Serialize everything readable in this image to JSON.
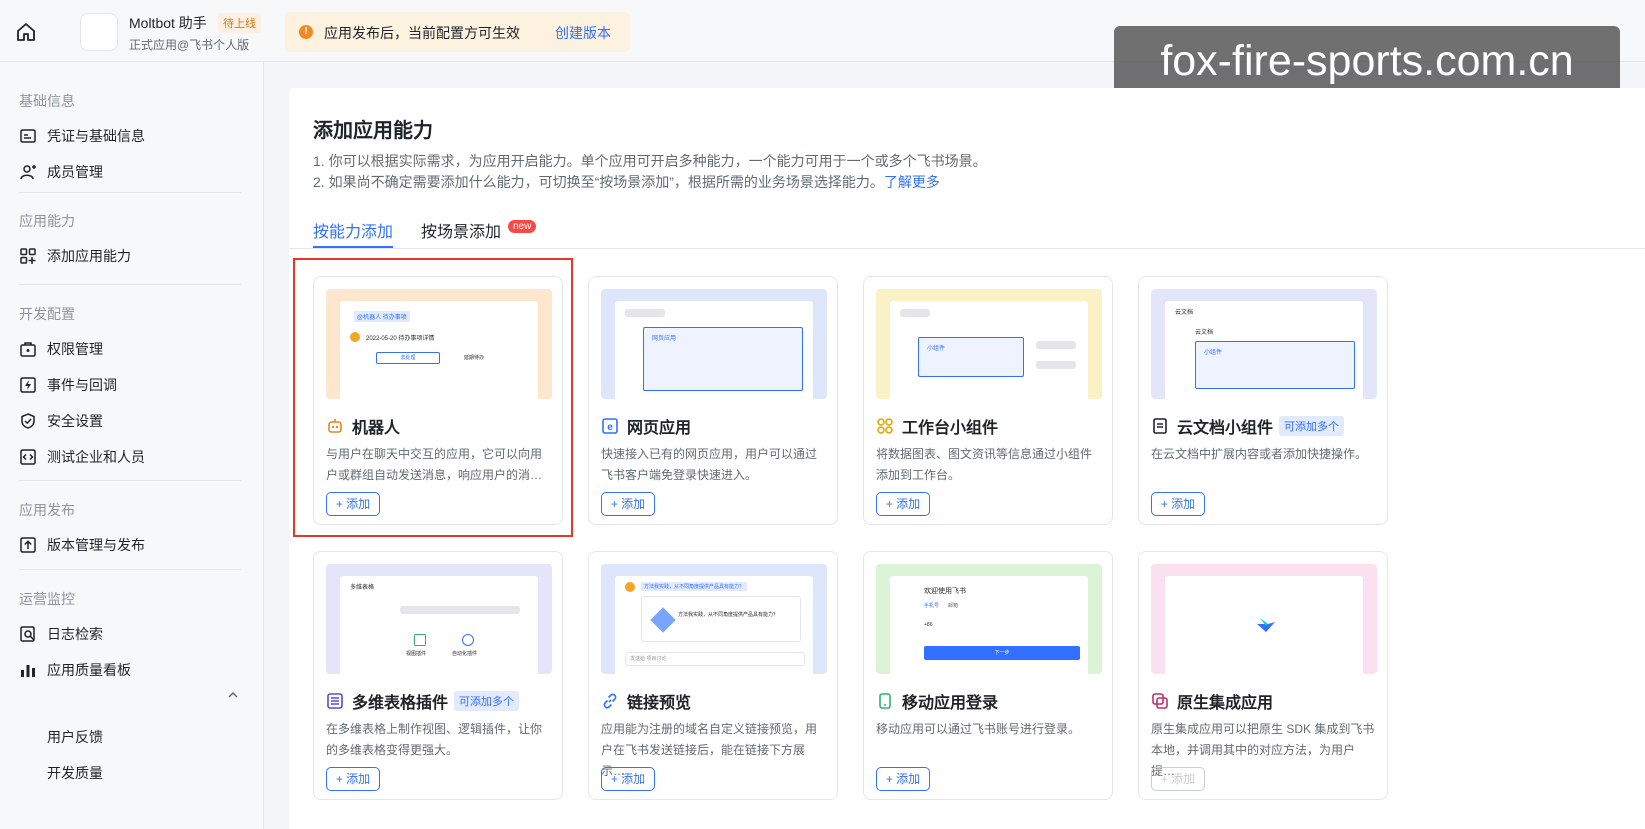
{
  "app": {
    "name": "Moltbot 助手",
    "badge": "待上线",
    "subtitle": "正式应用@飞书个人版"
  },
  "notice": {
    "icon": "warning-icon",
    "text": "应用发布后，当前配置方可生效",
    "link": "创建版本"
  },
  "watermark": "fox-fire-sports.com.cn",
  "sidebar": {
    "groups": [
      {
        "label": "基础信息",
        "items": [
          {
            "label": "凭证与基础信息",
            "icon": "credential-icon"
          },
          {
            "label": "成员管理",
            "icon": "user-add-icon"
          }
        ]
      },
      {
        "label": "应用能力",
        "items": [
          {
            "label": "添加应用能力",
            "icon": "apps-add-icon"
          }
        ]
      },
      {
        "label": "开发配置",
        "items": [
          {
            "label": "权限管理",
            "icon": "permission-icon"
          },
          {
            "label": "事件与回调",
            "icon": "event-icon"
          },
          {
            "label": "安全设置",
            "icon": "shield-icon"
          },
          {
            "label": "测试企业和人员",
            "icon": "code-icon"
          }
        ]
      },
      {
        "label": "应用发布",
        "items": [
          {
            "label": "版本管理与发布",
            "icon": "upload-icon"
          }
        ]
      },
      {
        "label": "运营监控",
        "items": [
          {
            "label": "日志检索",
            "icon": "log-search-icon"
          },
          {
            "label": "应用质量看板",
            "icon": "chart-icon"
          }
        ]
      }
    ],
    "sub_items": [
      "用户反馈",
      "开发质量"
    ]
  },
  "main": {
    "title": "添加应用能力",
    "desc1": "1. 你可以根据实际需求，为应用开启能力。单个应用可开启多种能力，一个能力可用于一个或多个飞书场景。",
    "desc2": "2. 如果尚不确定需要添加什么能力，可切换至“按场景添加”，根据所需的业务场景选择能力。",
    "desc2_link": "了解更多",
    "tabs": [
      {
        "label": "按能力添加"
      },
      {
        "label": "按场景添加",
        "badge": "new"
      }
    ],
    "cards": [
      {
        "title": "机器人",
        "icon": "robot-icon",
        "desc": "与用户在聊天中交互的应用，它可以向用户或群组自动发送消息，响应用户的消…",
        "add": "+ 添加",
        "thumb_color": "#fde8cf",
        "thumb_texts": [
          "@机器人 待办事项",
          "2022-05-20 待办事项详情",
          "去处理",
          "延期待办"
        ]
      },
      {
        "title": "网页应用",
        "icon": "web-app-icon",
        "desc": "快速接入已有的网页应用，用户可以通过飞书客户端免登录快速进入。",
        "add": "+ 添加",
        "thumb_color": "#dde6fb",
        "thumb_texts": [
          "网页应用"
        ]
      },
      {
        "title": "工作台小组件",
        "icon": "widget-icon",
        "desc": "将数据图表、图文资讯等信息通过小组件添加到工作台。",
        "add": "+ 添加",
        "thumb_color": "#fbf1c6",
        "thumb_texts": [
          "小组件"
        ]
      },
      {
        "title": "云文档小组件",
        "icon": "doc-icon",
        "multi": "可添加多个",
        "desc": "在云文档中扩展内容或者添加快捷操作。",
        "add": "+ 添加",
        "thumb_color": "#e3e5fa",
        "thumb_texts": [
          "云文档",
          "云文档",
          "小组件"
        ]
      },
      {
        "title": "多维表格插件",
        "icon": "table-icon",
        "multi": "可添加多个",
        "desc": "在多维表格上制作视图、逻辑插件，让你的多维表格变得更强大。",
        "add": "+ 添加",
        "thumb_color": "#e6e4fa",
        "thumb_texts": [
          "多维表格",
          "视图插件",
          "自动化插件"
        ]
      },
      {
        "title": "链接预览",
        "icon": "link-icon",
        "desc": "应用能为注册的域名自定义链接预览，用户在飞书发送链接后，能在链接下方展示…",
        "add": "+ 添加",
        "thumb_color": "#dde6fb",
        "thumb_texts": [
          "方法我实践，从不同角度提供产品具有能力？",
          "方法我实践，从不同角度提供产品具有能力？",
          "发送给 项目讨论"
        ]
      },
      {
        "title": "移动应用登录",
        "icon": "mobile-icon",
        "desc": "移动应用可以通过飞书账号进行登录。",
        "add": "+ 添加",
        "thumb_color": "#dcf3d7",
        "thumb_texts": [
          "欢迎使用飞书",
          "手机号",
          "邮箱",
          "+86",
          "下一步"
        ]
      },
      {
        "title": "原生集成应用",
        "icon": "native-icon",
        "desc": "原生集成应用可以把原生 SDK 集成到飞书本地，并调用其中的对应方法，为用户提…",
        "add": "+ 添加",
        "disabled": true,
        "thumb_color": "#fbe1ef",
        "thumb_texts": []
      }
    ]
  },
  "colors": {
    "accent": "#3370ff",
    "highlight": "#e2382b",
    "warning": "#f08a24"
  }
}
